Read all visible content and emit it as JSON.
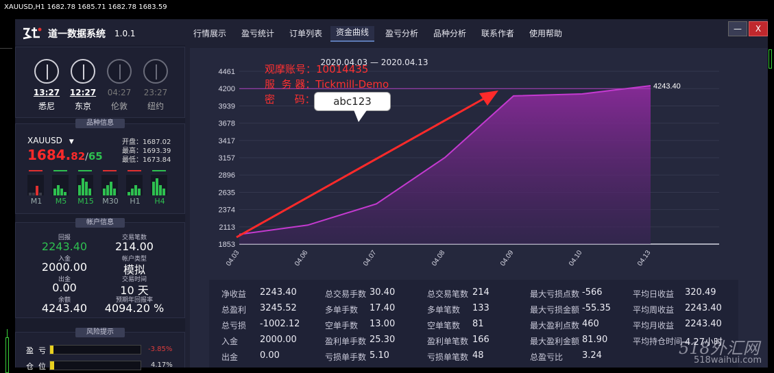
{
  "terminal": {
    "title": "XAUUSD,H1  1682.78 1685.71 1682.78 1683.59"
  },
  "app": {
    "logo_text": "道一数据系统",
    "version": "1.0.1",
    "tabs": [
      "行情展示",
      "盈亏统计",
      "订单列表",
      "资金曲线",
      "盈亏分析",
      "品种分析",
      "联系作者",
      "使用帮助"
    ],
    "active_tab": "资金曲线",
    "minimize_label": "—",
    "close_label": "X"
  },
  "clocks": [
    {
      "time": "13:27",
      "city": "悉尼",
      "active": true
    },
    {
      "time": "12:27",
      "city": "东京",
      "active": true
    },
    {
      "time": "04:27",
      "city": "伦敦",
      "active": false
    },
    {
      "time": "23:27",
      "city": "纽约",
      "active": false
    }
  ],
  "symbol_info": {
    "section_title": "品种信息",
    "symbol": "XAUUSD",
    "price_main": "1684.",
    "price_frac": "82",
    "price_sep": "/",
    "price_ask": "65",
    "open_label": "开盘：1687.02",
    "high_label": "最高：1693.39",
    "low_label": "最低：1673.84",
    "timeframes": [
      "M1",
      "M5",
      "M15",
      "M30",
      "H1",
      "H4"
    ]
  },
  "account_info": {
    "section_title": "帐户信息",
    "items": [
      {
        "label": "回报",
        "value": "2243.40"
      },
      {
        "label": "交易笔数",
        "value": "214.00"
      },
      {
        "label": "入金",
        "value": "2000.00"
      },
      {
        "label": "帐户类型",
        "value": "模拟"
      },
      {
        "label": "出金",
        "value": "0.00"
      },
      {
        "label": "交易时间",
        "value": "10 天"
      },
      {
        "label": "余额",
        "value": "4243.40"
      },
      {
        "label": "预期年回报率",
        "value": "4094.20 %"
      }
    ]
  },
  "risk": {
    "section_title": "风险提示",
    "items": [
      {
        "label": "盈  亏",
        "value": "-3.85%",
        "color": "#e03c3c"
      },
      {
        "label": "仓  位",
        "value": "4.17%",
        "color": "#d8d8d8"
      }
    ]
  },
  "overlay": {
    "account_line": "观摩账号：10014435",
    "server_line": "服  务 器：Tickmill-Demo",
    "password_label": "密      码：",
    "password_bubble": "abc123"
  },
  "chart_data": {
    "type": "area",
    "title": "2020.04.03 — 2020.04.13",
    "x": [
      "04.03",
      "04.06",
      "04.07",
      "04.08",
      "04.09",
      "04.10",
      "04.13"
    ],
    "values": [
      2000.0,
      2140.0,
      2460.0,
      3160.0,
      4090.0,
      4120.0,
      4243.4
    ],
    "yticks": [
      1853,
      2113,
      2374,
      2635,
      2896,
      3157,
      3417,
      3678,
      3939,
      4200,
      4461
    ],
    "ylim": [
      1853,
      4461
    ],
    "end_label": "4243.40",
    "reference_line": 4200,
    "grid": true
  },
  "stats": [
    [
      {
        "label": "净收益",
        "value": "2243.40"
      },
      {
        "label": "总盈利",
        "value": "3245.52"
      },
      {
        "label": "总亏损",
        "value": "-1002.12"
      },
      {
        "label": "入金",
        "value": "2000.00"
      },
      {
        "label": "出金",
        "value": "0.00"
      }
    ],
    [
      {
        "label": "总交易手数",
        "value": "30.40"
      },
      {
        "label": "多单手数",
        "value": "17.40"
      },
      {
        "label": "空单手数",
        "value": "13.00"
      },
      {
        "label": "盈利单手数",
        "value": "25.30"
      },
      {
        "label": "亏损单手数",
        "value": "5.10"
      }
    ],
    [
      {
        "label": "总交易笔数",
        "value": "214"
      },
      {
        "label": "多单笔数",
        "value": "133"
      },
      {
        "label": "空单笔数",
        "value": "81"
      },
      {
        "label": "盈利单笔数",
        "value": "166"
      },
      {
        "label": "亏损单笔数",
        "value": "48"
      }
    ],
    [
      {
        "label": "最大亏损点数",
        "value": "-566"
      },
      {
        "label": "最大亏损金额",
        "value": "-55.35"
      },
      {
        "label": "最大盈利点数",
        "value": "460"
      },
      {
        "label": "最大盈利金额",
        "value": "81.90"
      },
      {
        "label": "总盈亏比",
        "value": "3.24"
      }
    ],
    [
      {
        "label": "平均日收益",
        "value": "320.49"
      },
      {
        "label": "平均周收益",
        "value": "2243.40"
      },
      {
        "label": "平均月收益",
        "value": "2243.40"
      },
      {
        "label": "平均持仓时间",
        "value": "4.27小时"
      }
    ]
  ],
  "watermark": {
    "line1": "518外汇网",
    "line2": "518waihui.com"
  }
}
